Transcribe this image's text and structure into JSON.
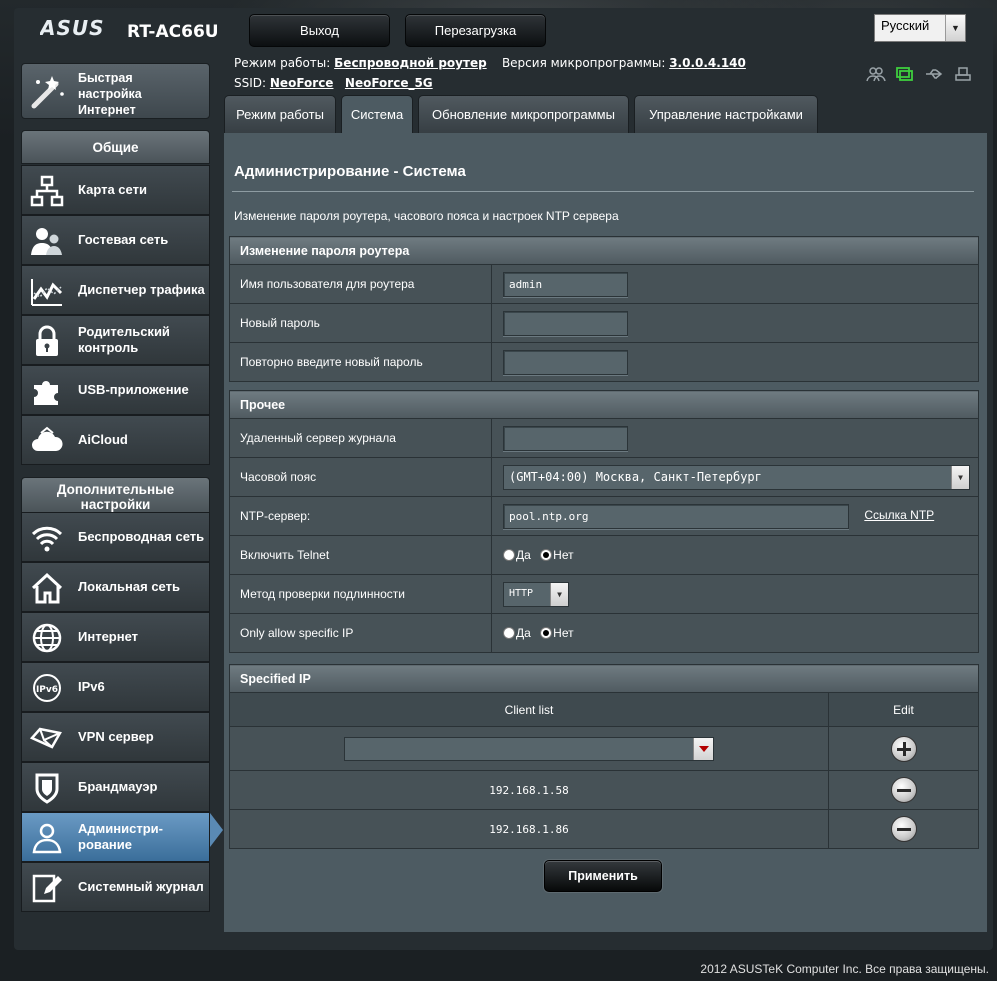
{
  "header": {
    "logo": "/ISUS",
    "model": "RT-AC66U",
    "logout_label": "Выход",
    "reboot_label": "Перезагрузка",
    "language": "Русский"
  },
  "info": {
    "mode_label": "Режим работы:",
    "mode_value": "Беспроводной роутер",
    "fw_label": "Версия микропрограммы:",
    "fw_value": "3.0.0.4.140",
    "ssid_label": "SSID:",
    "ssid_1": "NeoForce",
    "ssid_2": "NeoForce_5G"
  },
  "sidebar": {
    "quick_setup": "Быстрая настройка Интернет",
    "general_title": "Общие",
    "general_items": [
      {
        "label": "Карта сети"
      },
      {
        "label": "Гостевая сеть"
      },
      {
        "label": "Диспетчер трафика"
      },
      {
        "label": "Родительский контроль"
      },
      {
        "label": "USB-приложение"
      },
      {
        "label": "AiCloud"
      }
    ],
    "advanced_title": "Дополнительные настройки",
    "advanced_items": [
      {
        "label": "Беспроводная сеть"
      },
      {
        "label": "Локальная сеть"
      },
      {
        "label": "Интернет"
      },
      {
        "label": "IPv6"
      },
      {
        "label": "VPN сервер"
      },
      {
        "label": "Брандмауэр"
      },
      {
        "label": "Администри-рование"
      },
      {
        "label": "Системный журнал"
      }
    ]
  },
  "tabs": [
    {
      "label": "Режим работы"
    },
    {
      "label": "Система"
    },
    {
      "label": "Обновление микропрограммы"
    },
    {
      "label": "Управление настройками"
    }
  ],
  "main": {
    "title": "Администрирование - Система",
    "description": "Изменение пароля роутера, часового пояса и настроек NTP сервера",
    "password_section": {
      "title": "Изменение пароля роутера",
      "username_label": "Имя пользователя для роутера",
      "username_value": "admin",
      "new_password_label": "Новый пароль",
      "repeat_password_label": "Повторно введите новый пароль"
    },
    "misc_section": {
      "title": "Прочее",
      "log_server_label": "Удаленный сервер журнала",
      "timezone_label": "Часовой пояс",
      "timezone_value": "(GMT+04:00) Москва, Санкт-Петербург",
      "ntp_label": "NTP-сервер:",
      "ntp_value": "pool.ntp.org",
      "ntp_link": "Ссылка NTP",
      "telnet_label": "Включить Telnet",
      "yes": "Да",
      "no": "Нет",
      "auth_label": "Метод проверки подлинности",
      "auth_value": "HTTP",
      "specific_ip_label": "Only allow specific IP"
    },
    "specified_ip": {
      "title": "Specified IP",
      "col_client": "Client list",
      "col_edit": "Edit",
      "rows": [
        "192.168.1.58",
        "192.168.1.86"
      ]
    },
    "apply_label": "Применить"
  },
  "footer": "2012 ASUSTeK Computer Inc. Все права защищены."
}
